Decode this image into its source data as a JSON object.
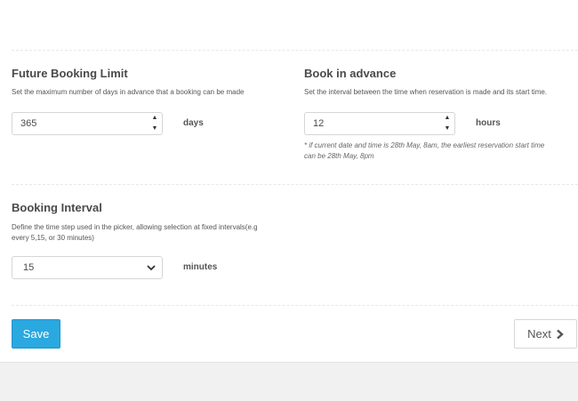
{
  "future_limit": {
    "title": "Future Booking Limit",
    "description": "Set the maximum number of days in advance that a booking can be made",
    "value": "365",
    "unit": "days"
  },
  "book_advance": {
    "title": "Book in advance",
    "description": "Set the interval between the time when reservation is made and its start time.",
    "value": "12",
    "unit": "hours",
    "note_line1": "* if current date and time is 28th May, 8am, the earliest reservation start time",
    "note_line2": "can be 28th May, 8pm"
  },
  "interval": {
    "title": "Booking Interval",
    "description_line1": "Define the time step used in the picker, allowing selection at fixed intervals(e.g",
    "description_line2": "every 5,15, or 30 minutes)",
    "selected": "15",
    "unit": "minutes"
  },
  "actions": {
    "save_label": "Save",
    "next_label": "Next"
  },
  "colors": {
    "save_button": "#2aa8e0",
    "footer_band": "#f1f1f1"
  },
  "icons": {
    "spin_up": "caret-up-icon",
    "spin_down": "caret-down-icon",
    "select": "chevron-down-icon",
    "next": "chevron-right-icon"
  }
}
